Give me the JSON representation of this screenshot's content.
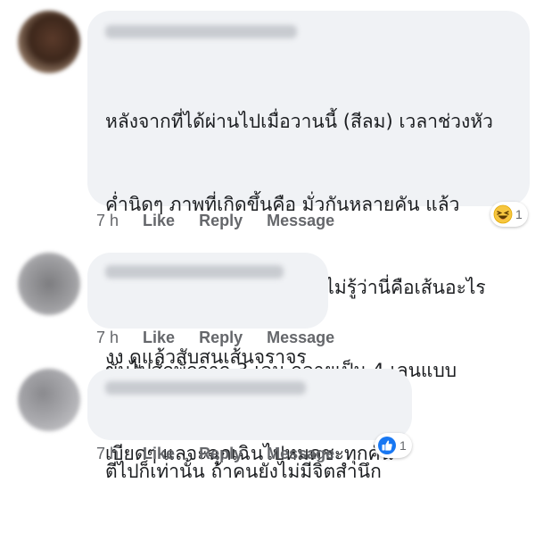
{
  "comments": [
    {
      "text_lines": [
        "หลังจากที่ได้ผ่านไปเมื่อวานนี้ (สีลม) เวลาช่วงหัว",
        "ค่ำนิดๆ ภาพที่เกิดขึ้นคือ มั่วกันหลายคัน แล้ว",
        "หลายคันขับตามๆกันเหมือนไม่รู้ว่านี่คือเส้นอะไร",
        "ขับไปสักพักจาก 3 เลน กลายเป็น 4 เลนแบบ",
        "เบียดๆ แลจะฉุกเฉินไปหมดชะทุกคัน"
      ],
      "time": "7 h",
      "like": "Like",
      "reply": "Reply",
      "message": "Message",
      "reaction": {
        "icon": "haha-emoji-icon",
        "count": "1"
      }
    },
    {
      "text_lines": [
        "งง ดูแล้วสับสนเส้นจราจร"
      ],
      "time": "7 h",
      "like": "Like",
      "reply": "Reply",
      "message": "Message"
    },
    {
      "text_lines": [
        "ตีไปก็เท่านั้น ถ้าคนยังไม่มีจิตสำนึก"
      ],
      "time": "7 h",
      "like": "Like",
      "reply": "Reply",
      "message": "Message",
      "reaction": {
        "icon": "like-thumb-icon",
        "count": "1"
      }
    }
  ],
  "colors": {
    "bubble": "#f0f2f5",
    "meta_text": "#65676b",
    "like_blue": "#1877f2",
    "haha_yellow": "#f7c63f"
  }
}
